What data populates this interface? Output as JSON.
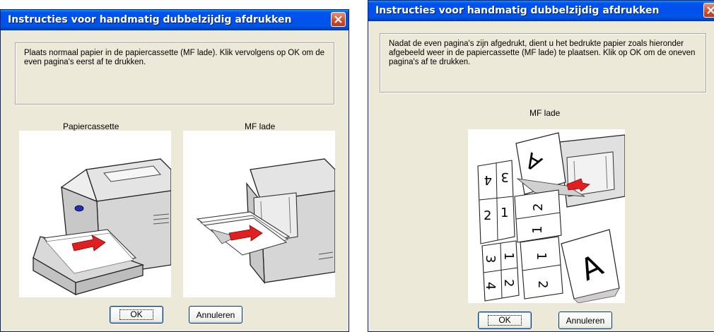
{
  "dialog1": {
    "title": "Instructies voor handmatig dubbelzijdig afdrukken",
    "message": "Plaats normaal papier in de papiercassette (MF lade). Klik vervolgens op OK om de even pagina's eerst af te drukken.",
    "label_left": "Papiercassette",
    "label_right": "MF lade",
    "ok_label": "OK",
    "cancel_label": "Annuleren"
  },
  "dialog2": {
    "title": "Instructies voor handmatig dubbelzijdig afdrukken",
    "message": "Nadat de even pagina's zijn afgedrukt, dient u het bedrukte papier zoals hieronder afgebeeld weer in de papiercassette (MF lade) te plaatsen. Klik op OK om de oneven pagina's af te drukken.",
    "label": "MF lade",
    "ok_label": "OK",
    "cancel_label": "Annuleren"
  },
  "icons": {
    "close": "close-icon"
  },
  "colors": {
    "titlebar": "#0054e3",
    "dialog_bg": "#ece9d8",
    "close_button": "#cf4a2e",
    "arrow": "#e02020"
  }
}
